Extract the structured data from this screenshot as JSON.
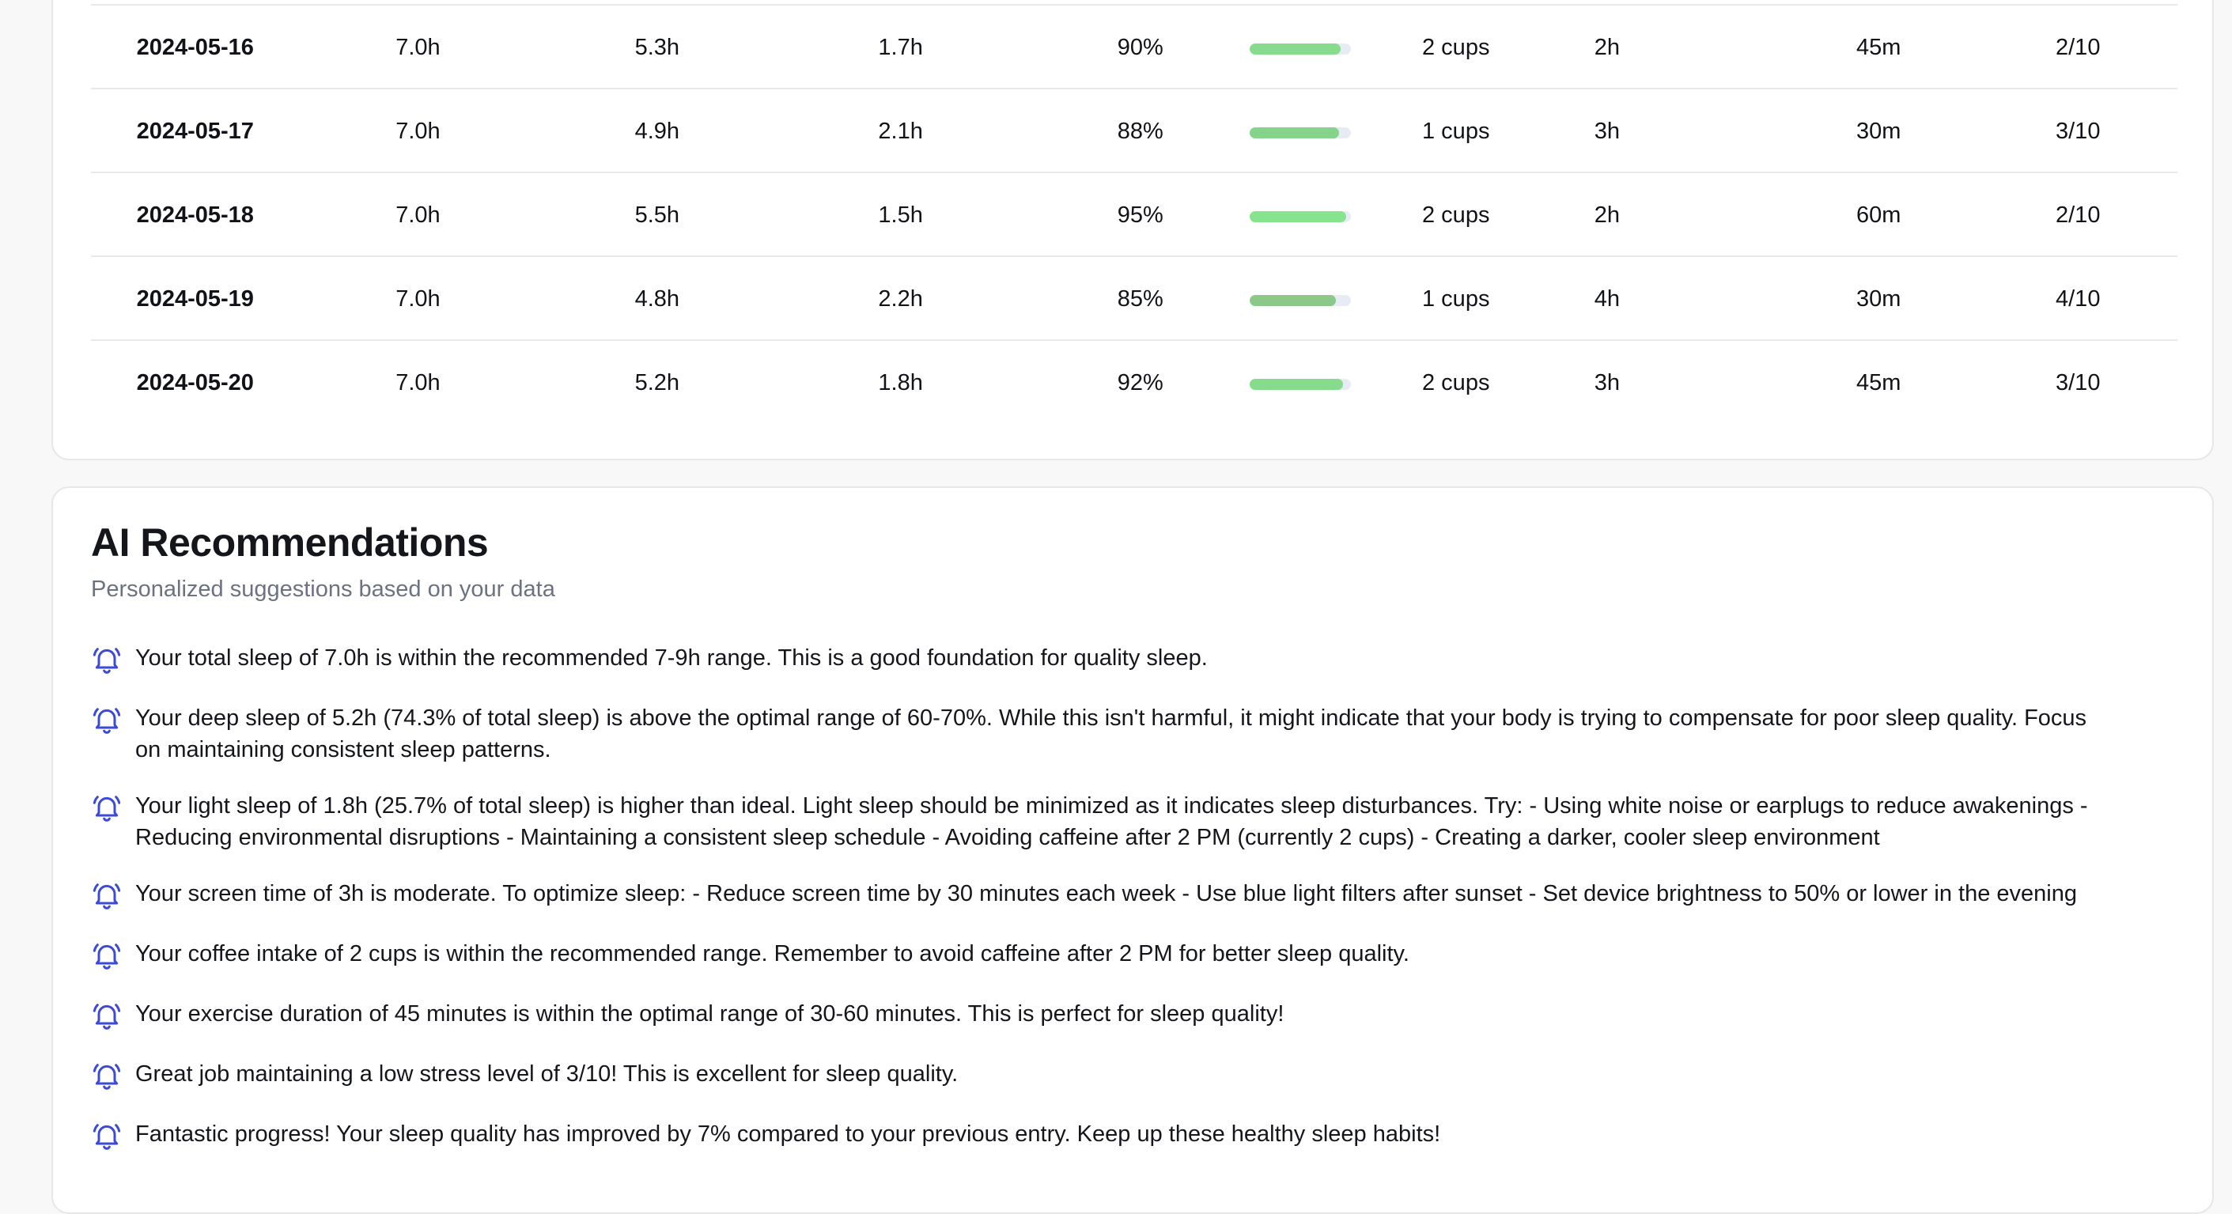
{
  "sleep_log": {
    "rows": [
      {
        "date": "2024-05-16",
        "total": "7.0h",
        "deep": "5.3h",
        "light": "1.7h",
        "quality": "90%",
        "quality_value": 90,
        "bar_color": "#86dc8c",
        "coffee": "2 cups",
        "screen": "2h",
        "exercise": "45m",
        "stress": "2/10"
      },
      {
        "date": "2024-05-17",
        "total": "7.0h",
        "deep": "4.9h",
        "light": "2.1h",
        "quality": "88%",
        "quality_value": 88,
        "bar_color": "#86d38c",
        "coffee": "1 cups",
        "screen": "3h",
        "exercise": "30m",
        "stress": "3/10"
      },
      {
        "date": "2024-05-18",
        "total": "7.0h",
        "deep": "5.5h",
        "light": "1.5h",
        "quality": "95%",
        "quality_value": 95,
        "bar_color": "#86e38e",
        "coffee": "2 cups",
        "screen": "2h",
        "exercise": "60m",
        "stress": "2/10"
      },
      {
        "date": "2024-05-19",
        "total": "7.0h",
        "deep": "4.8h",
        "light": "2.2h",
        "quality": "85%",
        "quality_value": 85,
        "bar_color": "#8cc88a",
        "coffee": "1 cups",
        "screen": "4h",
        "exercise": "30m",
        "stress": "4/10"
      },
      {
        "date": "2024-05-20",
        "total": "7.0h",
        "deep": "5.2h",
        "light": "1.8h",
        "quality": "92%",
        "quality_value": 92,
        "bar_color": "#86dc8c",
        "coffee": "2 cups",
        "screen": "3h",
        "exercise": "45m",
        "stress": "3/10"
      }
    ]
  },
  "recommendations": {
    "title": "AI Recommendations",
    "subtitle": "Personalized suggestions based on your data",
    "icon": "bell-icon",
    "icon_color": "#3b4bd8",
    "items": [
      {
        "line1": "Your total sleep of 7.0h is within the recommended 7-9h range. This is a good foundation for quality sleep.",
        "line2": ""
      },
      {
        "line1": "Your deep sleep of 5.2h (74.3% of total sleep) is above the optimal range of 60-70%. While this isn't harmful, it might indicate that your body is trying to compensate for poor sleep quality. Focus",
        "line2": "on maintaining consistent sleep patterns."
      },
      {
        "line1": "Your light sleep of 1.8h (25.7% of total sleep) is higher than ideal. Light sleep should be minimized as it indicates sleep disturbances. Try: - Using white noise or earplugs to reduce awakenings -",
        "line2": "Reducing environmental disruptions - Maintaining a consistent sleep schedule - Avoiding caffeine after 2 PM (currently 2 cups) - Creating a darker, cooler sleep environment"
      },
      {
        "line1": "Your screen time of 3h is moderate. To optimize sleep: - Reduce screen time by 30 minutes each week - Use blue light filters after sunset - Set device brightness to 50% or lower in the evening",
        "line2": ""
      },
      {
        "line1": "Your coffee intake of 2 cups is within the recommended range. Remember to avoid caffeine after 2 PM for better sleep quality.",
        "line2": ""
      },
      {
        "line1": "Your exercise duration of 45 minutes is within the optimal range of 30-60 minutes. This is perfect for sleep quality!",
        "line2": ""
      },
      {
        "line1": "Great job maintaining a low stress level of 3/10! This is excellent for sleep quality.",
        "line2": ""
      },
      {
        "line1": "Fantastic progress! Your sleep quality has improved by 7% compared to your previous entry. Keep up these healthy sleep habits!",
        "line2": ""
      }
    ]
  }
}
